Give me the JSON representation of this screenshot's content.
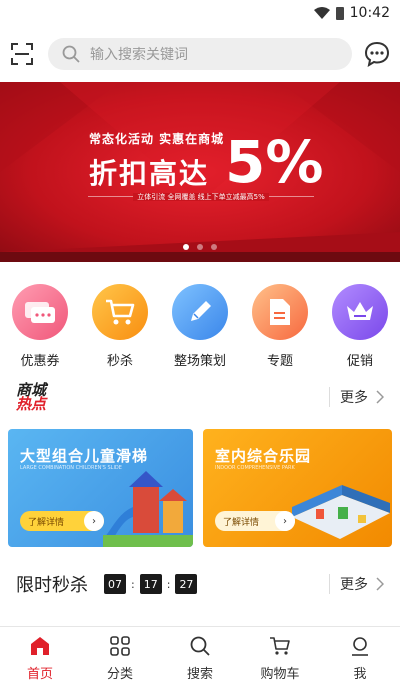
{
  "status": {
    "time": "10:42"
  },
  "search": {
    "placeholder": "输入搜索关键词"
  },
  "banner": {
    "line1": "常态化活动  实惠在商城",
    "line2": "折扣高达",
    "big": "5%",
    "sub": "立体引流 全网覆盖 线上下单立减最高5%"
  },
  "quick": [
    {
      "label": "优惠券",
      "icon": "coupon-chat-icon",
      "color": "#f06a8a"
    },
    {
      "label": "秒杀",
      "icon": "cart-icon",
      "color": "#f9a21e"
    },
    {
      "label": "整场策划",
      "icon": "pencil-icon",
      "color": "#4a9cf3"
    },
    {
      "label": "专题",
      "icon": "document-icon",
      "color": "#f97755"
    },
    {
      "label": "促销",
      "icon": "crown-icon",
      "color": "#8a5cf0"
    }
  ],
  "hot": {
    "line1": "商城",
    "line2": "热点",
    "more": "更多"
  },
  "cards": [
    {
      "title": "大型组合儿童滑梯",
      "sub": "LARGE COMBINATION CHILDREN'S SLIDE",
      "btn": "了解详情"
    },
    {
      "title": "室内综合乐园",
      "sub": "INDOOR COMPREHENSIVE PARK",
      "btn": "了解详情"
    }
  ],
  "flash": {
    "title": "限时秒杀",
    "h": "07",
    "m": "17",
    "s": "27",
    "sep": ":",
    "more": "更多"
  },
  "tabs": [
    {
      "label": "首页",
      "icon": "home-icon"
    },
    {
      "label": "分类",
      "icon": "grid-icon"
    },
    {
      "label": "搜索",
      "icon": "search-icon"
    },
    {
      "label": "购物车",
      "icon": "cart-icon"
    },
    {
      "label": "我",
      "icon": "user-icon"
    }
  ],
  "colors": {
    "accent": "#e0202a"
  }
}
